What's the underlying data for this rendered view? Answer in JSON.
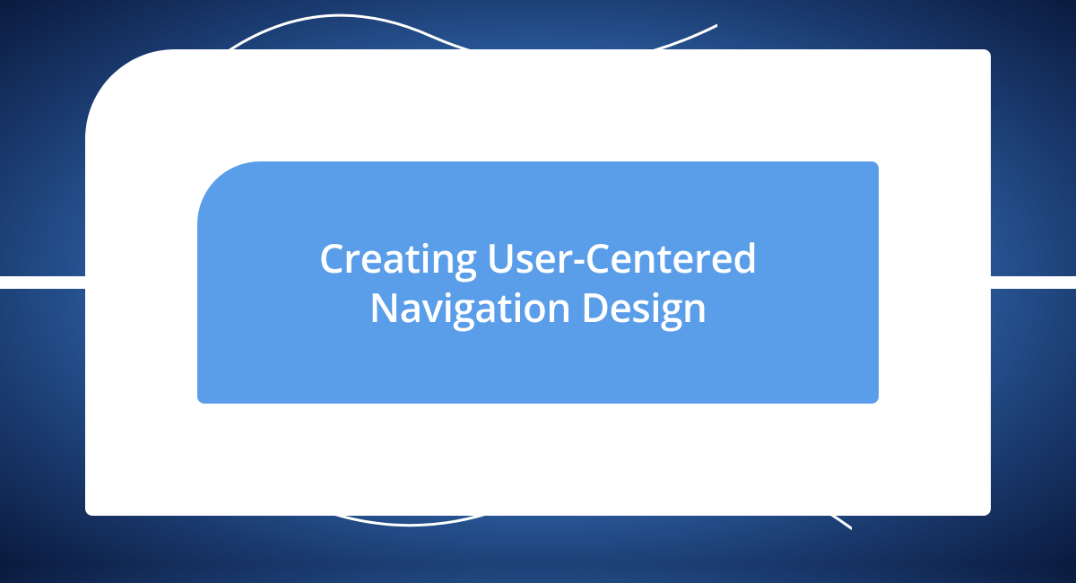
{
  "title": "Creating User-Centered Navigation Design",
  "colors": {
    "accent_blue": "#5a9de8",
    "dark_navy": "#0a1a3e",
    "white": "#ffffff"
  }
}
